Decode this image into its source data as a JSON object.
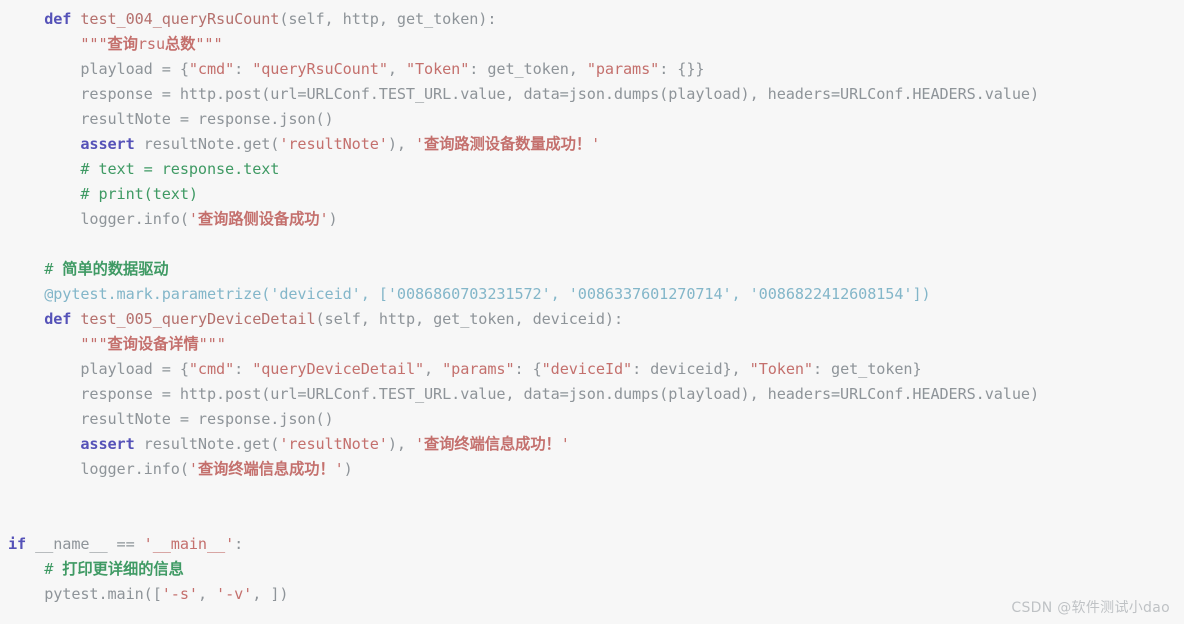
{
  "editor": {
    "language": "Python",
    "background_color": "#f7f7f7",
    "colors": {
      "plain": "#8e9499",
      "keyword": "#5552b8",
      "function_name": "#b5706d",
      "string": "#c4706d",
      "comment": "#3f9a64",
      "decorator": "#83b6c9"
    }
  },
  "watermark": {
    "text": "CSDN @软件测试小dao"
  },
  "code": {
    "lines": [
      {
        "id": "line-1",
        "indent": 4,
        "tokens": [
          {
            "kind": "keyword",
            "text": "def "
          },
          {
            "kind": "funcname",
            "text": "test_004_queryRsuCount"
          },
          {
            "kind": "plain",
            "text": "(self, http, get_token):"
          }
        ]
      },
      {
        "id": "line-2",
        "indent": 8,
        "tokens": [
          {
            "kind": "string",
            "text": "\"\"\""
          },
          {
            "kind": "string",
            "cjk": true,
            "text": "查询"
          },
          {
            "kind": "string",
            "text": "rsu"
          },
          {
            "kind": "string",
            "cjk": true,
            "text": "总数"
          },
          {
            "kind": "string",
            "text": "\"\"\""
          }
        ]
      },
      {
        "id": "line-3",
        "indent": 8,
        "tokens": [
          {
            "kind": "plain",
            "text": "playload = {"
          },
          {
            "kind": "string",
            "text": "\"cmd\""
          },
          {
            "kind": "plain",
            "text": ": "
          },
          {
            "kind": "string",
            "text": "\"queryRsuCount\""
          },
          {
            "kind": "plain",
            "text": ", "
          },
          {
            "kind": "string",
            "text": "\"Token\""
          },
          {
            "kind": "plain",
            "text": ": get_token, "
          },
          {
            "kind": "string",
            "text": "\"params\""
          },
          {
            "kind": "plain",
            "text": ": {}}"
          }
        ]
      },
      {
        "id": "line-4",
        "indent": 8,
        "tokens": [
          {
            "kind": "plain",
            "text": "response = http.post(url=URLConf.TEST_URL.value, data=json.dumps(playload), headers=URLConf.HEADERS.value)"
          }
        ]
      },
      {
        "id": "line-5",
        "indent": 8,
        "tokens": [
          {
            "kind": "plain",
            "text": "resultNote = response.json()"
          }
        ]
      },
      {
        "id": "line-6",
        "indent": 8,
        "tokens": [
          {
            "kind": "keyword",
            "text": "assert "
          },
          {
            "kind": "plain",
            "text": "resultNote.get("
          },
          {
            "kind": "string",
            "text": "'resultNote'"
          },
          {
            "kind": "plain",
            "text": "), "
          },
          {
            "kind": "string",
            "text": "'"
          },
          {
            "kind": "string",
            "cjk": true,
            "text": "查询路测设备数量成功！"
          },
          {
            "kind": "string",
            "text": "'"
          }
        ]
      },
      {
        "id": "line-7",
        "indent": 8,
        "tokens": [
          {
            "kind": "comment",
            "text": "# text = response.text"
          }
        ]
      },
      {
        "id": "line-8",
        "indent": 8,
        "tokens": [
          {
            "kind": "comment",
            "text": "# print(text)"
          }
        ]
      },
      {
        "id": "line-9",
        "indent": 8,
        "tokens": [
          {
            "kind": "plain",
            "text": "logger.info("
          },
          {
            "kind": "string",
            "text": "'"
          },
          {
            "kind": "string",
            "cjk": true,
            "text": "查询路侧设备成功"
          },
          {
            "kind": "string",
            "text": "'"
          },
          {
            "kind": "plain",
            "text": ")"
          }
        ]
      },
      {
        "id": "line-10",
        "indent": 0,
        "blank": true,
        "tokens": []
      },
      {
        "id": "line-11",
        "indent": 4,
        "tokens": [
          {
            "kind": "comment",
            "text": "# "
          },
          {
            "kind": "comment",
            "cjk": true,
            "text": "简单的数据驱动"
          }
        ]
      },
      {
        "id": "line-12",
        "indent": 4,
        "tokens": [
          {
            "kind": "decorator",
            "text": "@pytest.mark.parametrize("
          },
          {
            "kind": "decorator",
            "text": "'deviceid'"
          },
          {
            "kind": "decorator",
            "text": ", ["
          },
          {
            "kind": "decorator",
            "text": "'0086860703231572'"
          },
          {
            "kind": "decorator",
            "text": ", "
          },
          {
            "kind": "decorator",
            "text": "'0086337601270714'"
          },
          {
            "kind": "decorator",
            "text": ", "
          },
          {
            "kind": "decorator",
            "text": "'0086822412608154'"
          },
          {
            "kind": "decorator",
            "text": "])"
          }
        ]
      },
      {
        "id": "line-13",
        "indent": 4,
        "tokens": [
          {
            "kind": "keyword",
            "text": "def "
          },
          {
            "kind": "funcname",
            "text": "test_005_queryDeviceDetail"
          },
          {
            "kind": "plain",
            "text": "(self, http, get_token, deviceid):"
          }
        ]
      },
      {
        "id": "line-14",
        "indent": 8,
        "tokens": [
          {
            "kind": "string",
            "text": "\"\"\""
          },
          {
            "kind": "string",
            "cjk": true,
            "text": "查询设备详情"
          },
          {
            "kind": "string",
            "text": "\"\"\""
          }
        ]
      },
      {
        "id": "line-15",
        "indent": 8,
        "tokens": [
          {
            "kind": "plain",
            "text": "playload = {"
          },
          {
            "kind": "string",
            "text": "\"cmd\""
          },
          {
            "kind": "plain",
            "text": ": "
          },
          {
            "kind": "string",
            "text": "\"queryDeviceDetail\""
          },
          {
            "kind": "plain",
            "text": ", "
          },
          {
            "kind": "string",
            "text": "\"params\""
          },
          {
            "kind": "plain",
            "text": ": {"
          },
          {
            "kind": "string",
            "text": "\"deviceId\""
          },
          {
            "kind": "plain",
            "text": ": deviceid}, "
          },
          {
            "kind": "string",
            "text": "\"Token\""
          },
          {
            "kind": "plain",
            "text": ": get_token}"
          }
        ]
      },
      {
        "id": "line-16",
        "indent": 8,
        "tokens": [
          {
            "kind": "plain",
            "text": "response = http.post(url=URLConf.TEST_URL.value, data=json.dumps(playload), headers=URLConf.HEADERS.value)"
          }
        ]
      },
      {
        "id": "line-17",
        "indent": 8,
        "tokens": [
          {
            "kind": "plain",
            "text": "resultNote = response.json()"
          }
        ]
      },
      {
        "id": "line-18",
        "indent": 8,
        "tokens": [
          {
            "kind": "keyword",
            "text": "assert "
          },
          {
            "kind": "plain",
            "text": "resultNote.get("
          },
          {
            "kind": "string",
            "text": "'resultNote'"
          },
          {
            "kind": "plain",
            "text": "), "
          },
          {
            "kind": "string",
            "text": "'"
          },
          {
            "kind": "string",
            "cjk": true,
            "text": "查询终端信息成功！"
          },
          {
            "kind": "string",
            "text": "'"
          }
        ]
      },
      {
        "id": "line-19",
        "indent": 8,
        "tokens": [
          {
            "kind": "plain",
            "text": "logger.info("
          },
          {
            "kind": "string",
            "text": "'"
          },
          {
            "kind": "string",
            "cjk": true,
            "text": "查询终端信息成功！"
          },
          {
            "kind": "string",
            "text": "'"
          },
          {
            "kind": "plain",
            "text": ")"
          }
        ]
      },
      {
        "id": "line-20",
        "indent": 0,
        "blank": true,
        "tokens": []
      },
      {
        "id": "line-21",
        "indent": 0,
        "blank": true,
        "tokens": []
      },
      {
        "id": "line-22",
        "indent": 0,
        "tokens": [
          {
            "kind": "keyword",
            "text": "if "
          },
          {
            "kind": "plain",
            "text": "__name__ == "
          },
          {
            "kind": "string",
            "text": "'__main__'"
          },
          {
            "kind": "plain",
            "text": ":"
          }
        ]
      },
      {
        "id": "line-23",
        "indent": 4,
        "tokens": [
          {
            "kind": "comment",
            "text": "# "
          },
          {
            "kind": "comment",
            "cjk": true,
            "text": "打印更详细的信息"
          }
        ]
      },
      {
        "id": "line-24",
        "indent": 4,
        "tokens": [
          {
            "kind": "plain",
            "text": "pytest.main(["
          },
          {
            "kind": "string",
            "text": "'-s'"
          },
          {
            "kind": "plain",
            "text": ", "
          },
          {
            "kind": "string",
            "text": "'-v'"
          },
          {
            "kind": "plain",
            "text": ", ])"
          }
        ]
      }
    ]
  }
}
